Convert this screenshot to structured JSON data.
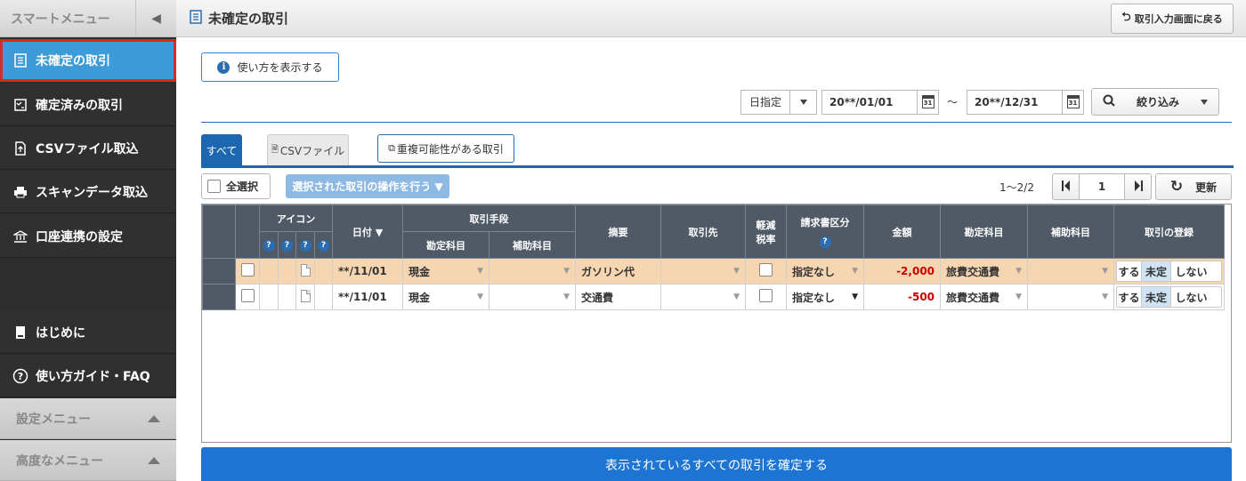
{
  "sidebar": {
    "title": "スマートメニュー",
    "items": [
      {
        "label": "未確定の取引"
      },
      {
        "label": "確定済みの取引"
      },
      {
        "label": "CSVファイル取込"
      },
      {
        "label": "スキャンデータ取込"
      },
      {
        "label": "口座連携の設定"
      },
      {
        "label": "はじめに"
      },
      {
        "label": "使い方ガイド・FAQ"
      }
    ],
    "settings_menu": "設定メニュー",
    "advanced_menu": "高度なメニュー"
  },
  "header": {
    "page_title": "未確定の取引",
    "back_button": "取引入力画面に戻る"
  },
  "howto_button": "使い方を表示する",
  "filter": {
    "date_mode": "日指定",
    "date_from": "20**/01/01",
    "tilde": "～",
    "date_to": "20**/12/31",
    "calendar_num": "31",
    "narrow_button": "絞り込み"
  },
  "tabs": {
    "all": "すべて",
    "csv": "CSVファイル",
    "duplicate": "重複可能性がある取引"
  },
  "toolbar": {
    "select_all": "全選択",
    "operation": "選択された取引の操作を行う ▼",
    "page_count": "1～2/2",
    "page_number": "1",
    "refresh": "更新"
  },
  "table": {
    "headers": {
      "icon": "アイコン",
      "date": "日付 ▼",
      "method": "取引手段",
      "method_account": "勘定科目",
      "method_sub": "補助科目",
      "summary": "摘要",
      "partner": "取引先",
      "reduced_tax_1": "軽減",
      "reduced_tax_2": "税率",
      "invoice": "請求書区分",
      "amount": "金額",
      "account": "勘定科目",
      "sub_account": "補助科目",
      "register": "取引の登録"
    },
    "rows": [
      {
        "date": "**/11/01",
        "method_account": "現金",
        "summary": "ガソリン代",
        "invoice": "指定なし",
        "amount": "-2,000",
        "account": "旅費交通費",
        "highlighted": true
      },
      {
        "date": "**/11/01",
        "method_account": "現金",
        "summary": "交通費",
        "invoice": "指定なし",
        "amount": "-500",
        "account": "旅費交通費",
        "highlighted": false
      }
    ],
    "register_options": [
      "する",
      "未定",
      "しない"
    ],
    "register_selected": "未定"
  },
  "confirm_button": "表示されているすべての取引を確定する",
  "colors": {
    "accent": "#1d74d2",
    "sidebar_active": "#3d9bd8",
    "highlight_row": "#f6d6b1",
    "negative_amount": "#cc0000"
  }
}
